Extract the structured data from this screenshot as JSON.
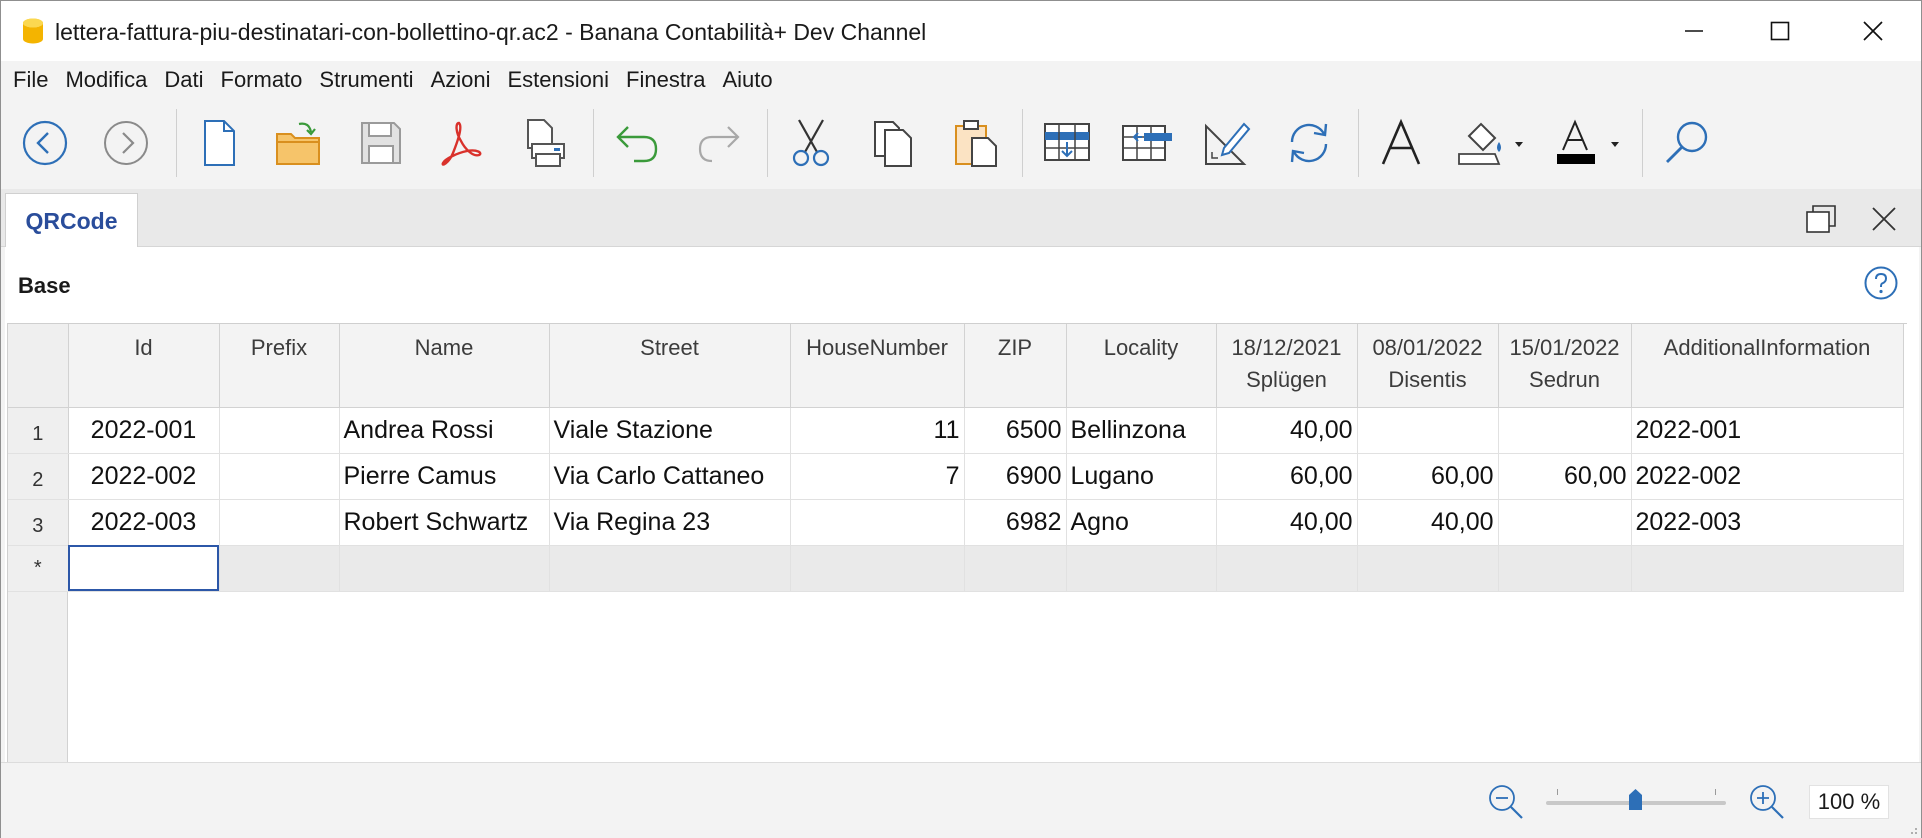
{
  "window": {
    "title": "lettera-fattura-piu-destinatari-con-bollettino-qr.ac2 - Banana Contabilità+ Dev Channel"
  },
  "menu": [
    "File",
    "Modifica",
    "Dati",
    "Formato",
    "Strumenti",
    "Azioni",
    "Estensioni",
    "Finestra",
    "Aiuto"
  ],
  "toolbar": {
    "icons": [
      "back-icon",
      "forward-icon",
      "new-file-icon",
      "open-file-icon",
      "save-icon",
      "pdf-icon",
      "print-preview-icon",
      "undo-icon",
      "redo-icon",
      "cut-icon",
      "copy-icon",
      "paste-icon",
      "insert-rows-icon",
      "add-column-icon",
      "edit-ruler-icon",
      "refresh-icon",
      "font-icon",
      "fill-color-icon",
      "text-color-icon",
      "search-icon"
    ]
  },
  "tab": {
    "label": "QRCode"
  },
  "section": {
    "title": "Base"
  },
  "table": {
    "columns": [
      {
        "line1": "Id",
        "line2": ""
      },
      {
        "line1": "Prefix",
        "line2": ""
      },
      {
        "line1": "Name",
        "line2": ""
      },
      {
        "line1": "Street",
        "line2": ""
      },
      {
        "line1": "HouseNumber",
        "line2": ""
      },
      {
        "line1": "ZIP",
        "line2": ""
      },
      {
        "line1": "Locality",
        "line2": ""
      },
      {
        "line1": "18/12/2021",
        "line2": "Splügen"
      },
      {
        "line1": "08/01/2022",
        "line2": "Disentis"
      },
      {
        "line1": "15/01/2022",
        "line2": "Sedrun"
      },
      {
        "line1": "AdditionalInformation",
        "line2": ""
      }
    ],
    "rows": [
      {
        "num": "1",
        "cells": [
          "2022-001",
          "",
          "Andrea Rossi",
          "Viale Stazione",
          "11",
          "6500",
          "Bellinzona",
          "40,00",
          "",
          "",
          "2022-001"
        ]
      },
      {
        "num": "2",
        "cells": [
          "2022-002",
          "",
          "Pierre Camus",
          "Via Carlo Cattaneo",
          "7",
          "6900",
          "Lugano",
          "60,00",
          "60,00",
          "60,00",
          "2022-002"
        ]
      },
      {
        "num": "3",
        "cells": [
          "2022-003",
          "",
          "Robert Schwartz",
          "Via Regina 23",
          "",
          "6982",
          "Agno",
          "40,00",
          "40,00",
          "",
          "2022-003"
        ]
      }
    ],
    "new_row_marker": "*"
  },
  "status": {
    "zoom": "100 %",
    "zoom_level": 100
  },
  "colors": {
    "accent": "#2c57a8",
    "tab_text": "#2a4d9b",
    "icon_blue": "#2d6fb7"
  }
}
